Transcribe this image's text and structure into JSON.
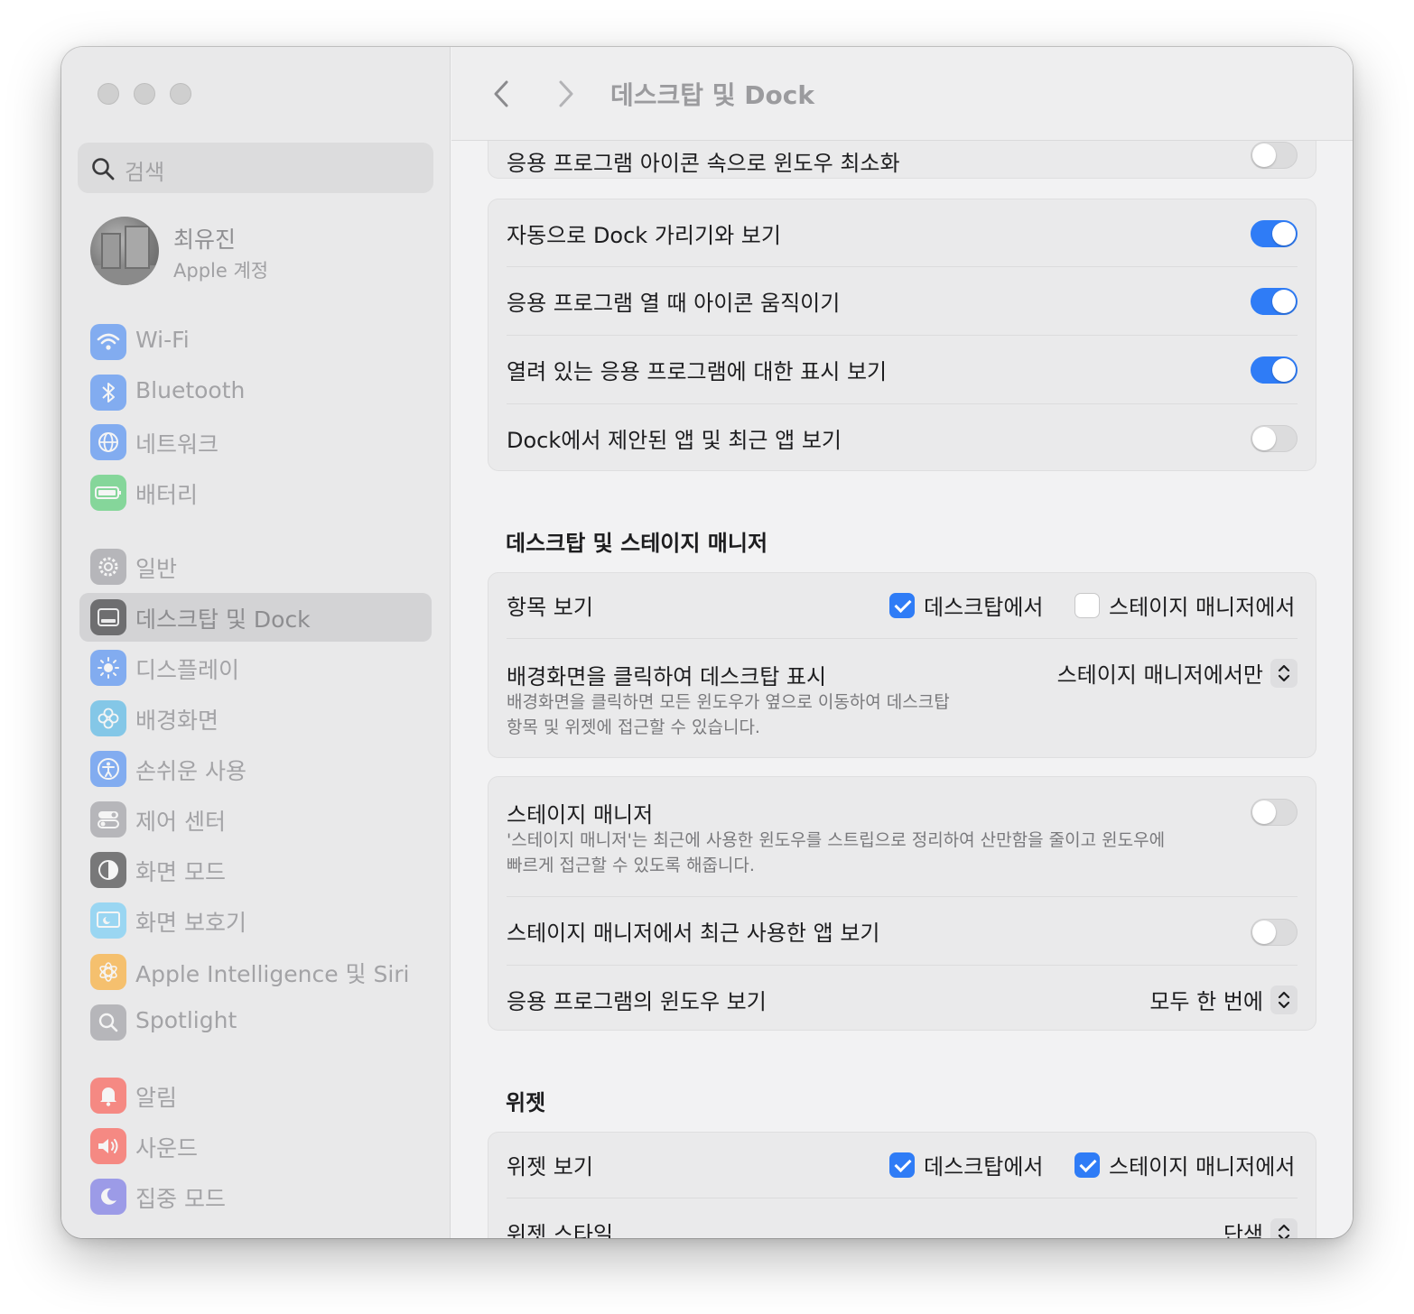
{
  "window": {
    "title": "데스크탑 및 Dock"
  },
  "search": {
    "placeholder": "검색"
  },
  "profile": {
    "name": "최유진",
    "subtitle": "Apple 계정"
  },
  "sidebar": {
    "items": [
      {
        "label": "Wi-Fi",
        "icon": "wifi-icon",
        "color": "#2f7cf6"
      },
      {
        "label": "Bluetooth",
        "icon": "bluetooth-icon",
        "color": "#2f7cf6"
      },
      {
        "label": "네트워크",
        "icon": "globe-icon",
        "color": "#2f7cf6"
      },
      {
        "label": "배터리",
        "icon": "battery-icon",
        "color": "#34c759"
      },
      {
        "label": "일반",
        "icon": "gear-icon",
        "color": "#8e8e93"
      },
      {
        "label": "데스크탑 및 Dock",
        "icon": "dock-icon",
        "color": "#1c1c1e",
        "active": true
      },
      {
        "label": "디스플레이",
        "icon": "sun-icon",
        "color": "#2f7cf6"
      },
      {
        "label": "배경화면",
        "icon": "flower-icon",
        "color": "#32ade6"
      },
      {
        "label": "손쉬운 사용",
        "icon": "accessibility-icon",
        "color": "#2f7cf6"
      },
      {
        "label": "제어 센터",
        "icon": "control-center-icon",
        "color": "#8e8e93"
      },
      {
        "label": "화면 모드",
        "icon": "appearance-icon",
        "color": "#1c1c1e"
      },
      {
        "label": "화면 보호기",
        "icon": "screensaver-icon",
        "color": "#5ac8fa"
      },
      {
        "label": "Apple Intelligence 및 Siri",
        "icon": "siri-icon",
        "color": "#ff9f0a"
      },
      {
        "label": "Spotlight",
        "icon": "magnifier-icon",
        "color": "#8e8e93"
      },
      {
        "label": "알림",
        "icon": "bell-icon",
        "color": "#ff3b30"
      },
      {
        "label": "사운드",
        "icon": "speaker-icon",
        "color": "#ff3b30"
      },
      {
        "label": "집중 모드",
        "icon": "moon-icon",
        "color": "#5e5ce6"
      }
    ]
  },
  "dock_section": {
    "partial_row": {
      "label": "응용 프로그램 아이콘 속으로 윈도우 최소화",
      "on": false
    },
    "rows": [
      {
        "label": "자동으로 Dock 가리기와 보기",
        "on": true
      },
      {
        "label": "응용 프로그램 열 때 아이콘 움직이기",
        "on": true
      },
      {
        "label": "열려 있는 응용 프로그램에 대한 표시 보기",
        "on": true
      },
      {
        "label": "Dock에서 제안된 앱 및 최근 앱 보기",
        "on": false
      }
    ]
  },
  "desktop_stage": {
    "title": "데스크탑 및 스테이지 매니저",
    "show_items": {
      "label": "항목 보기",
      "desktop": "데스크탑에서",
      "desktop_checked": true,
      "stage": "스테이지 매니저에서",
      "stage_checked": false
    },
    "click_wallpaper": {
      "label": "배경화면을 클릭하여 데스크탑 표시",
      "desc1": "배경화면을 클릭하면 모든 윈도우가 옆으로 이동하여 데스크탑",
      "desc2": "항목 및 위젯에 접근할 수 있습니다.",
      "value": "스테이지 매니저에서만"
    },
    "stage_manager": {
      "label": "스테이지 매니저",
      "desc1": "'스테이지 매니저'는 최근에 사용한 윈도우를 스트립으로 정리하여 산만함을 줄이고 윈도우에",
      "desc2": "빠르게 접근할 수 있도록 해줍니다.",
      "on": false
    },
    "recent_apps": {
      "label": "스테이지 매니저에서 최근 사용한 앱 보기",
      "on": false
    },
    "app_windows": {
      "label": "응용 프로그램의 윈도우 보기",
      "value": "모두 한 번에"
    }
  },
  "widgets": {
    "title": "위젯",
    "show": {
      "label": "위젯 보기",
      "desktop": "데스크탑에서",
      "desktop_checked": true,
      "stage": "스테이지 매니저에서",
      "stage_checked": true
    },
    "style": {
      "label": "위젯 스타일",
      "value": "단색"
    }
  }
}
